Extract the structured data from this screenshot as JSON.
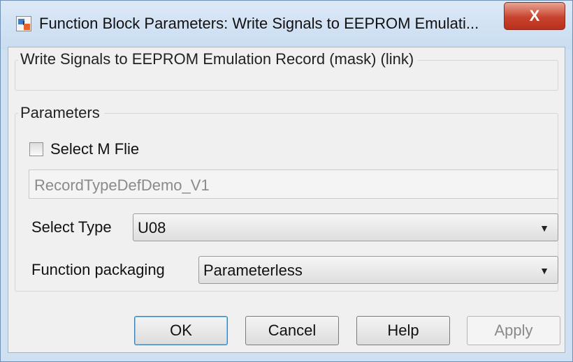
{
  "window": {
    "title": "Function Block Parameters: Write Signals to EEPROM Emulati...",
    "close_label": "X"
  },
  "description_group": {
    "title": "Write Signals to EEPROM Emulation Record (mask) (link)"
  },
  "parameters_group": {
    "title": "Parameters",
    "select_m_file": {
      "label": "Select M Flie",
      "checked": false
    },
    "record_field": {
      "value": "RecordTypeDefDemo_V1"
    },
    "select_type": {
      "label": "Select Type",
      "value": "U08"
    },
    "function_packaging": {
      "label": "Function packaging",
      "value": "Parameterless"
    }
  },
  "buttons": {
    "ok": "OK",
    "cancel": "Cancel",
    "help": "Help",
    "apply": "Apply"
  },
  "colors": {
    "frame": "#cfe0f3",
    "client_bg": "#f0f0f0",
    "close_button": "#c8432f",
    "default_button_border": "#3c7fb1"
  }
}
